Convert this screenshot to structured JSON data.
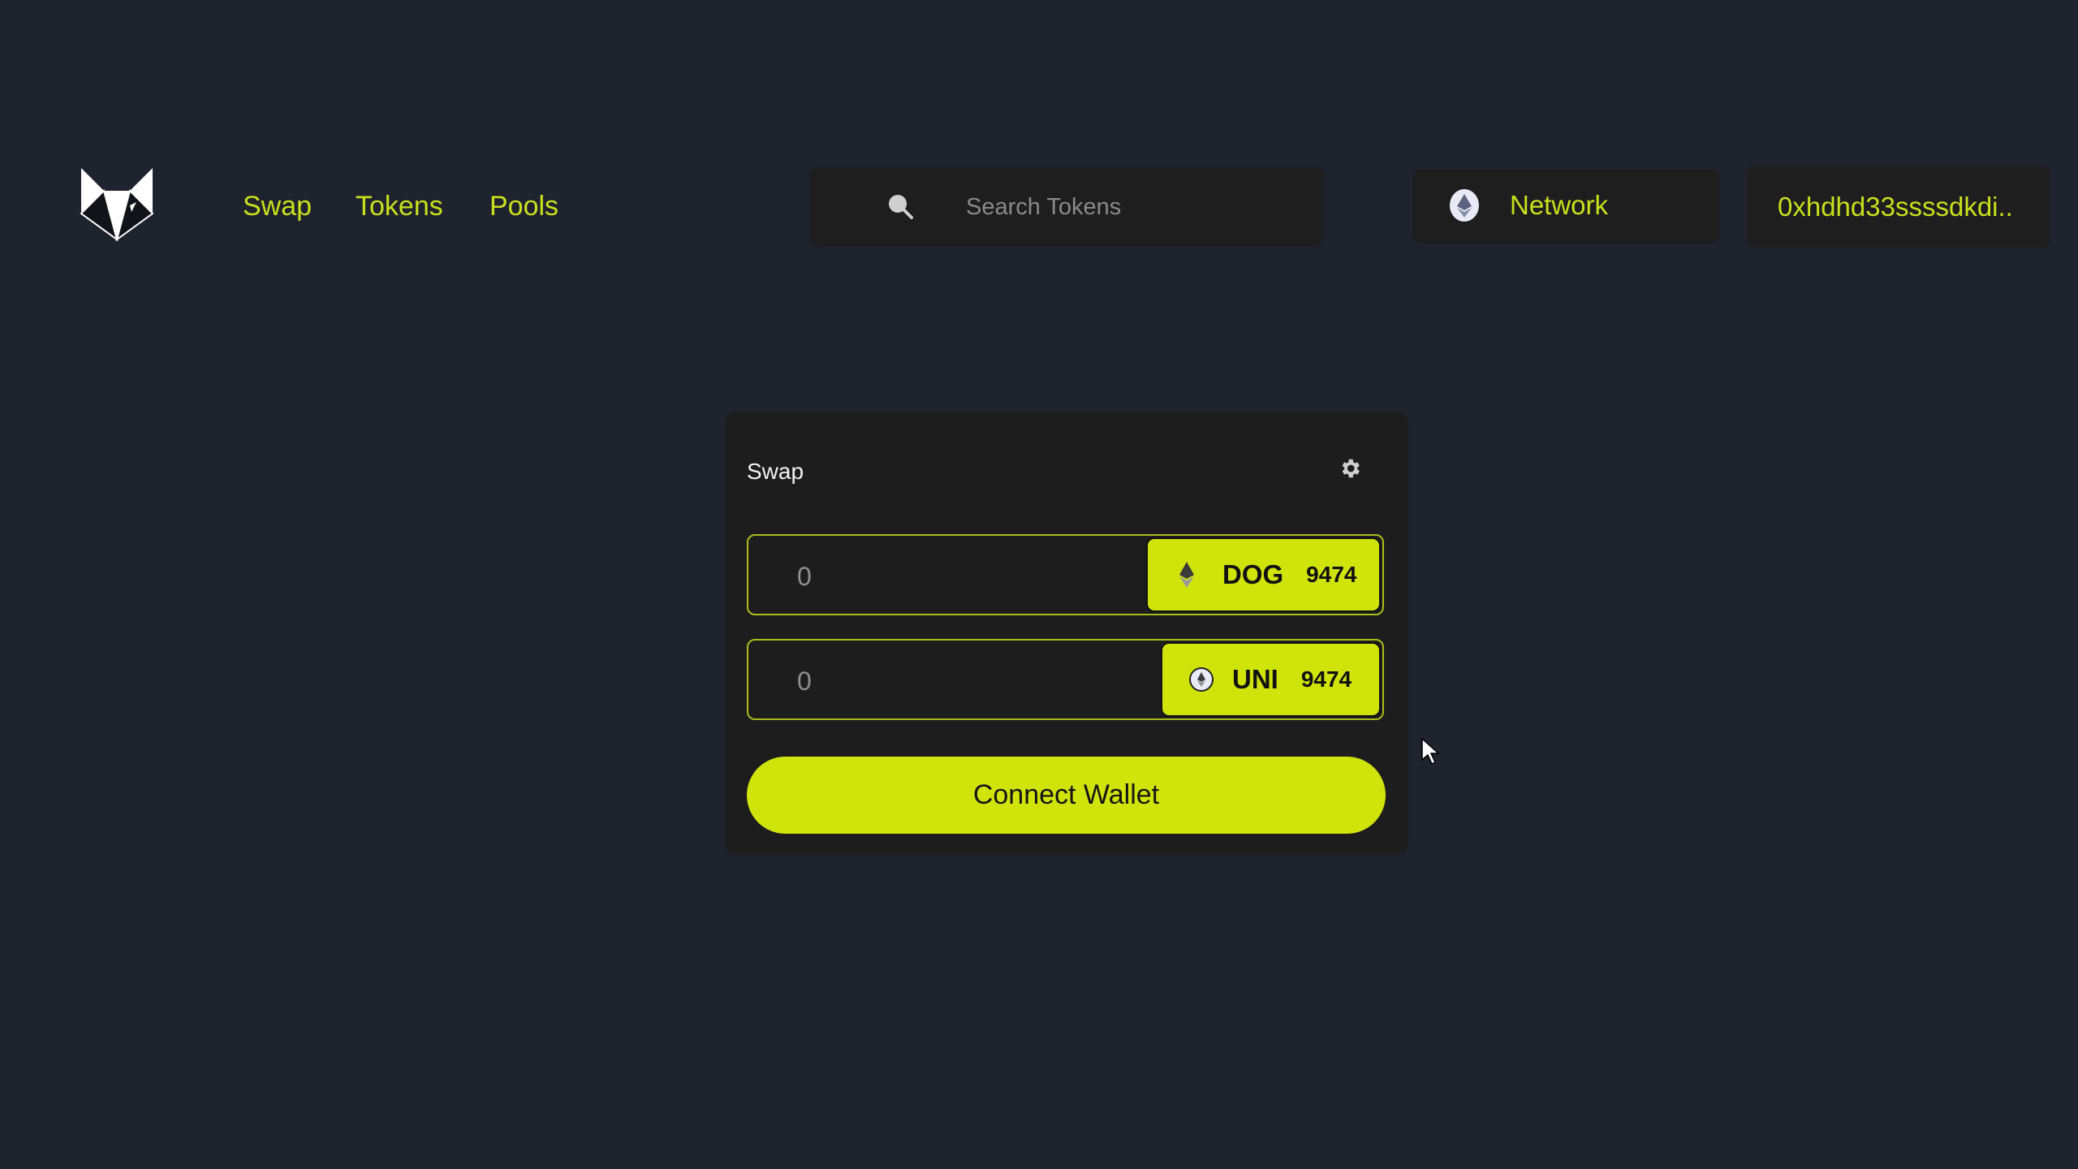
{
  "header": {
    "logo": "fox-logo",
    "nav": [
      {
        "label": "Swap"
      },
      {
        "label": "Tokens"
      },
      {
        "label": "Pools"
      }
    ],
    "search": {
      "icon": "search-icon",
      "placeholder": "Search Tokens",
      "value": ""
    },
    "network": {
      "icon": "ethereum-icon",
      "label": "Network"
    },
    "wallet_address": "0xhdhd33ssssdkdi.."
  },
  "swap_card": {
    "title": "Swap",
    "settings_icon": "gear-icon",
    "from": {
      "amount_placeholder": "0",
      "token_icon": "ethereum-icon",
      "symbol": "DOG",
      "balance": "9474"
    },
    "to": {
      "amount_placeholder": "0",
      "token_icon": "ethereum-circle-icon",
      "symbol": "UNI",
      "balance": "9474"
    },
    "connect_label": "Connect Wallet"
  },
  "colors": {
    "background": "#1f232e",
    "panel": "#1d1d1e",
    "accent": "#d0e40c",
    "nav_text": "#c8e01c"
  }
}
